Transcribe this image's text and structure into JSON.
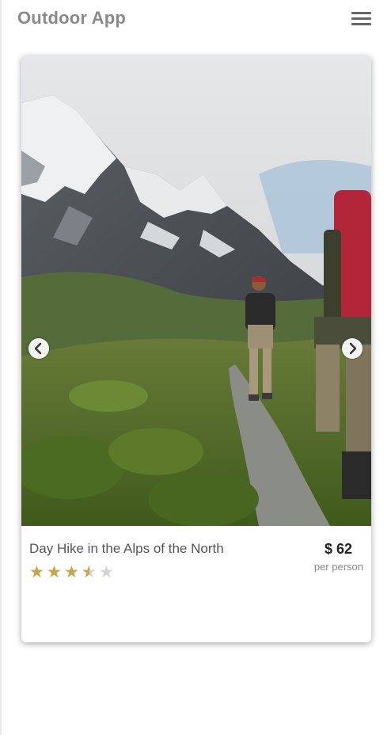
{
  "header": {
    "app_title": "Outdoor App",
    "menu_icon": "hamburger-menu-icon"
  },
  "card": {
    "image_description": "photo",
    "nav": {
      "prev_icon": "chevron-left-icon",
      "next_icon": "chevron-right-icon"
    },
    "title": "Day Hike in the Alps of the North",
    "price": "$ 62",
    "price_unit": "per person",
    "rating": {
      "value": 3.5,
      "max": 5
    }
  },
  "colors": {
    "title_gray": "#8a8a8a",
    "star_gold": "#c8a546",
    "star_empty": "#d3d3d3"
  }
}
